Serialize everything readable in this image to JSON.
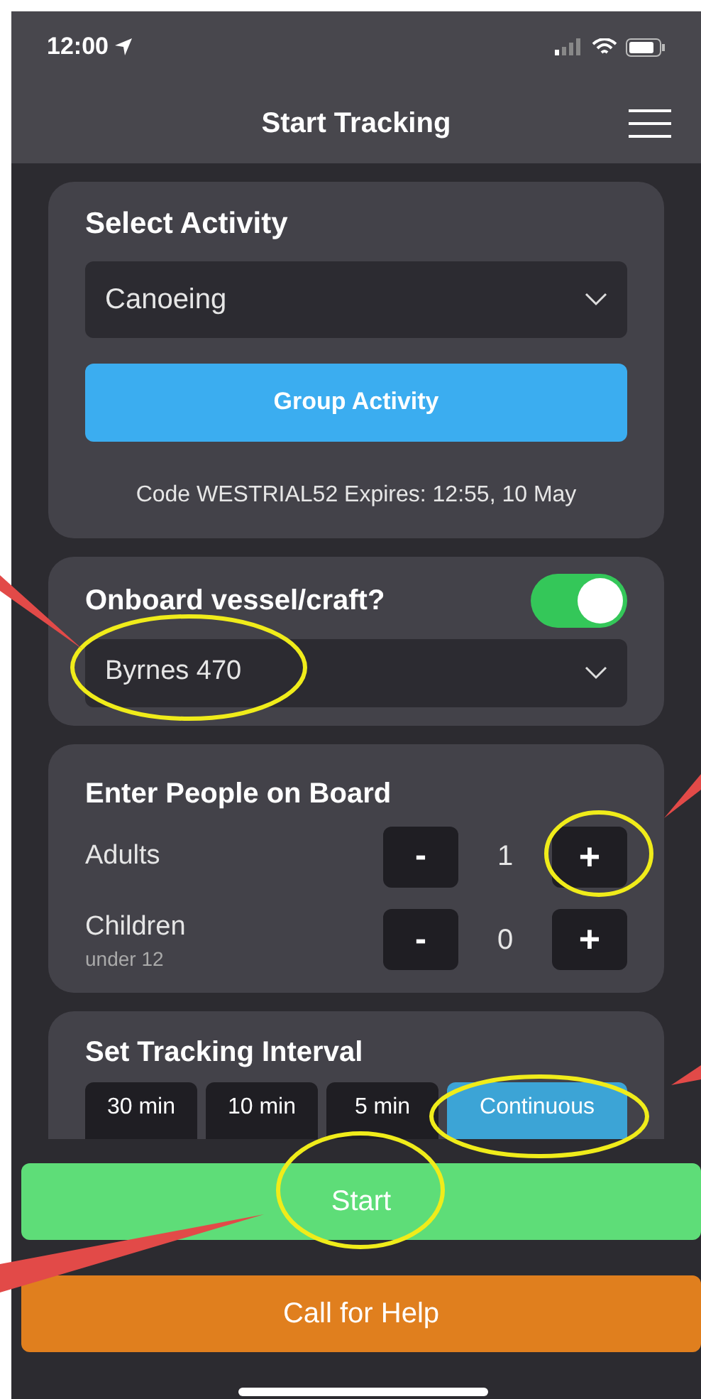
{
  "status_bar": {
    "time": "12:00"
  },
  "header": {
    "title": "Start Tracking"
  },
  "activity": {
    "title": "Select Activity",
    "value": "Canoeing",
    "group_button": "Group Activity",
    "code_text": "Code WESTRIAL52 Expires: 12:55, 10 May"
  },
  "vessel": {
    "title": "Onboard vessel/craft?",
    "on": true,
    "value": "Byrnes 470"
  },
  "people": {
    "title": "Enter People on Board",
    "rows": [
      {
        "label": "Adults",
        "count": "1",
        "minus": "-",
        "plus": "+"
      },
      {
        "label": "Children",
        "sublabel": "under 12",
        "count": "0",
        "minus": "-",
        "plus": "+"
      }
    ]
  },
  "interval": {
    "title": "Set Tracking Interval",
    "options": [
      {
        "label": "30 min",
        "selected": false
      },
      {
        "label": "10 min",
        "selected": false
      },
      {
        "label": "5 min",
        "selected": false
      },
      {
        "label": "Continuous",
        "selected": true
      }
    ]
  },
  "buttons": [
    {
      "kind": "start",
      "label": "Start"
    },
    {
      "kind": "help",
      "label": "Call for Help"
    }
  ]
}
